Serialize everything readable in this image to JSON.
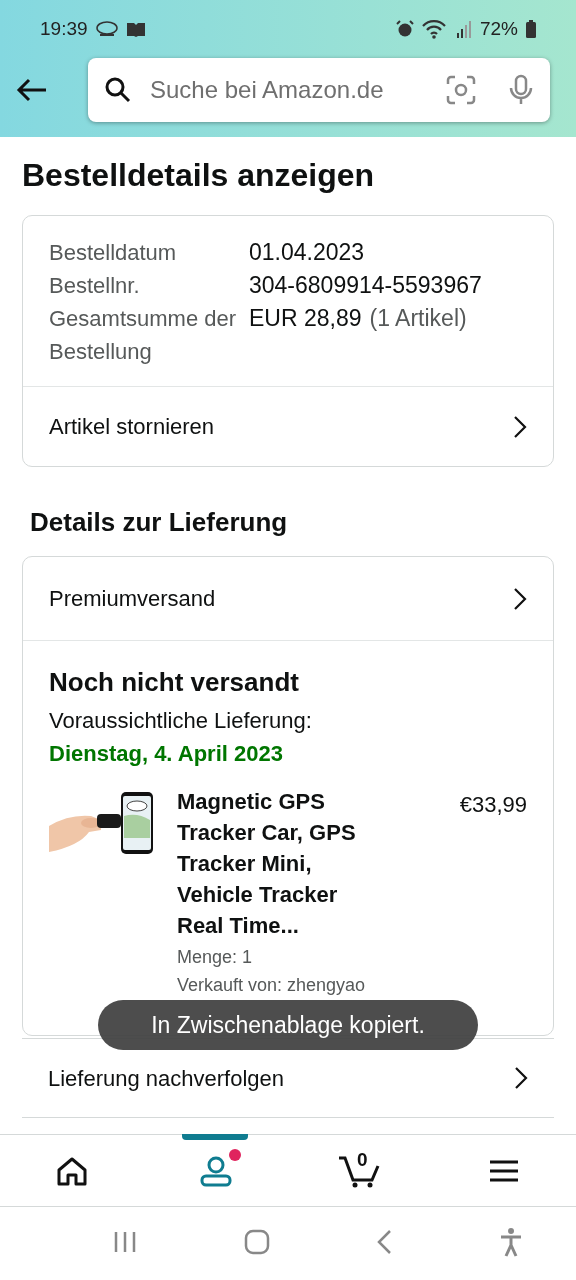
{
  "status_bar": {
    "time": "19:39",
    "battery": "72%"
  },
  "search": {
    "placeholder": "Suche bei Amazon.de"
  },
  "page_title": "Bestelldetails anzeigen",
  "order_summary": {
    "rows": [
      {
        "label": "Bestelldatum",
        "value": "01.04.2023"
      },
      {
        "label": "Bestellnr.",
        "value": "304-6809914-5593967"
      },
      {
        "label": "Gesamtsumme der Bestellung",
        "value": "EUR 28,89",
        "note": "(1 Artikel)"
      }
    ],
    "action": "Artikel stornieren"
  },
  "delivery_section_title": "Details zur Lieferung",
  "shipping_method": "Premiumversand",
  "shipment": {
    "status": "Noch nicht versandt",
    "eta_label": "Voraussichtliche Lieferung:",
    "eta_date": "Dienstag, 4. April 2023",
    "item": {
      "title": "Magnetic GPS Tracker Car, GPS Tracker Mini, Vehicle Tracker Real Time...",
      "price": "€33,99",
      "quantity": "Menge: 1",
      "seller": "Verkauft von: zhengyao"
    }
  },
  "track_action": "Lieferung nachverfolgen",
  "toast": "In Zwischenablage kopiert.",
  "bottom_nav": [
    {
      "kind": "home",
      "selected": false
    },
    {
      "kind": "account",
      "selected": true,
      "notification": true
    },
    {
      "kind": "cart",
      "selected": false,
      "count": "0"
    },
    {
      "kind": "menu",
      "selected": false
    }
  ]
}
